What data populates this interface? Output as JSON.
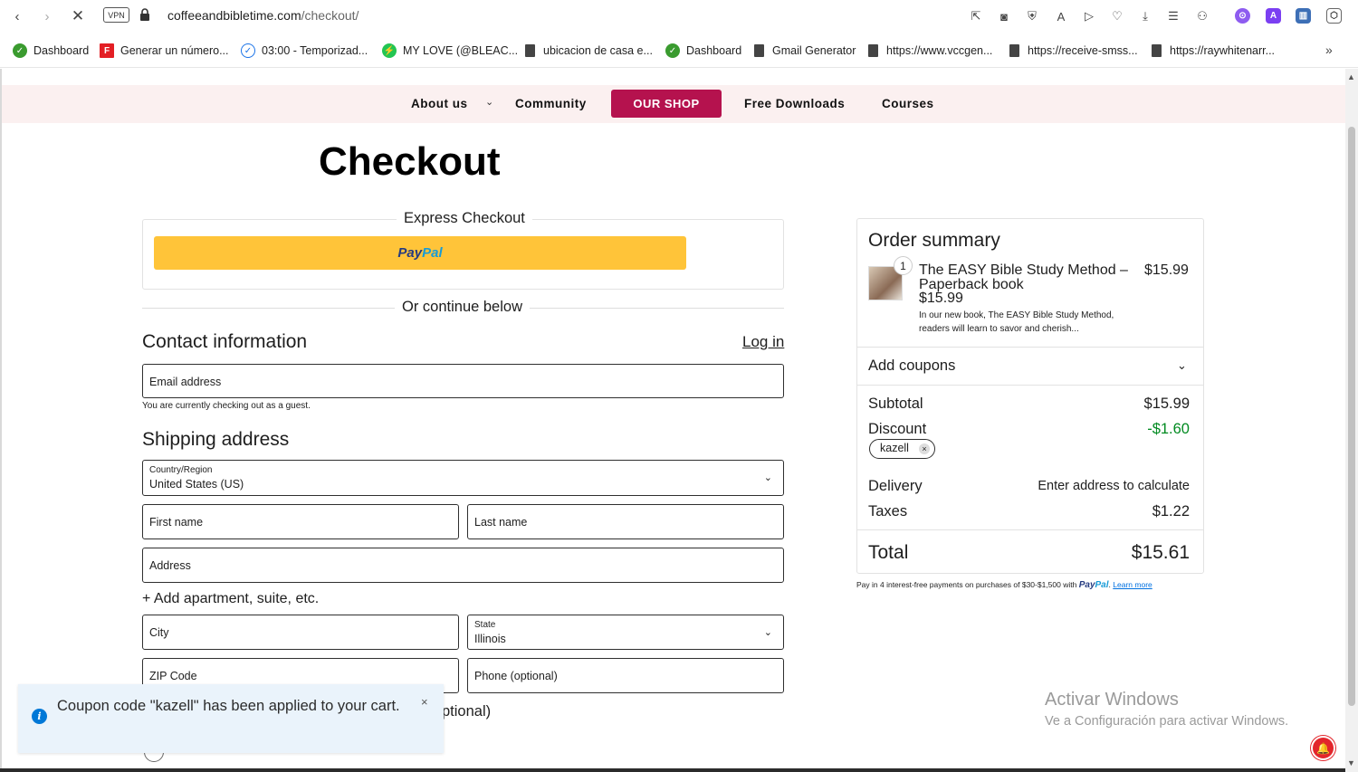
{
  "browser": {
    "url_domain": "coffeeandbibletime.com",
    "url_path": "/checkout/",
    "vpn_label": "VPN"
  },
  "bookmarks": [
    {
      "label": "Dashboard",
      "icon": "green-leaf-icon"
    },
    {
      "label": "Generar un número...",
      "icon": "f-logo-icon"
    },
    {
      "label": "03:00 - Temporizad...",
      "icon": "check-circle-icon"
    },
    {
      "label": "MY LOVE (@BLEAC...",
      "icon": "bolt-icon"
    },
    {
      "label": "ubicacion de casa e...",
      "icon": "page-icon"
    },
    {
      "label": "Dashboard",
      "icon": "green-leaf-icon"
    },
    {
      "label": "Gmail Generator",
      "icon": "page-icon"
    },
    {
      "label": "https://www.vccgen...",
      "icon": "page-icon"
    },
    {
      "label": "https://receive-smss...",
      "icon": "page-icon"
    },
    {
      "label": "https://raywhitenarr...",
      "icon": "page-icon"
    }
  ],
  "nav": {
    "about": "About us",
    "community": "Community",
    "shop": "OUR SHOP",
    "downloads": "Free Downloads",
    "courses": "Courses",
    "shop_color": "#b5124e"
  },
  "checkout": {
    "title": "Checkout",
    "express_label": "Express Checkout",
    "paypal_a": "Pay",
    "paypal_b": "Pal",
    "or_label": "Or continue below",
    "contact_title": "Contact information",
    "login": "Log in",
    "email_placeholder": "Email address",
    "guest_note": "You are currently checking out as a guest.",
    "shipping_title": "Shipping address",
    "country_label": "Country/Region",
    "country_value": "United States (US)",
    "first_name": "First name",
    "last_name": "Last name",
    "address": "Address",
    "add_apt": "+ Add apartment, suite, etc.",
    "city": "City",
    "state_label": "State",
    "state_value": "Illinois",
    "zip": "ZIP Code",
    "phone": "Phone (optional)",
    "optional_fragment": "ptional)"
  },
  "summary": {
    "title": "Order summary",
    "qty": "1",
    "product_name": "The EASY Bible Study Method – Paperback book",
    "product_unit_price": "$15.99",
    "product_desc": "In our new book, The EASY Bible Study Method, readers will learn to savor and cherish...",
    "product_price": "$15.99",
    "add_coupons": "Add coupons",
    "subtotal_label": "Subtotal",
    "subtotal": "$15.99",
    "discount_label": "Discount",
    "discount": "-$1.60",
    "coupon_code": "kazell",
    "delivery_label": "Delivery",
    "delivery": "Enter address to calculate",
    "taxes_label": "Taxes",
    "taxes": "$1.22",
    "total_label": "Total",
    "total": "$15.61",
    "paylater_text": "Pay in 4 interest-free payments on purchases of $30-$1,500 with",
    "paylater_a": "Pay",
    "paylater_b": "Pal",
    "learn_more": "Learn more"
  },
  "toast": {
    "message": "Coupon code \"kazell\" has been applied to your cart.",
    "close": "×"
  },
  "watermark": {
    "line1": "Activar Windows",
    "line2": "Ve a Configuración para activar Windows."
  }
}
